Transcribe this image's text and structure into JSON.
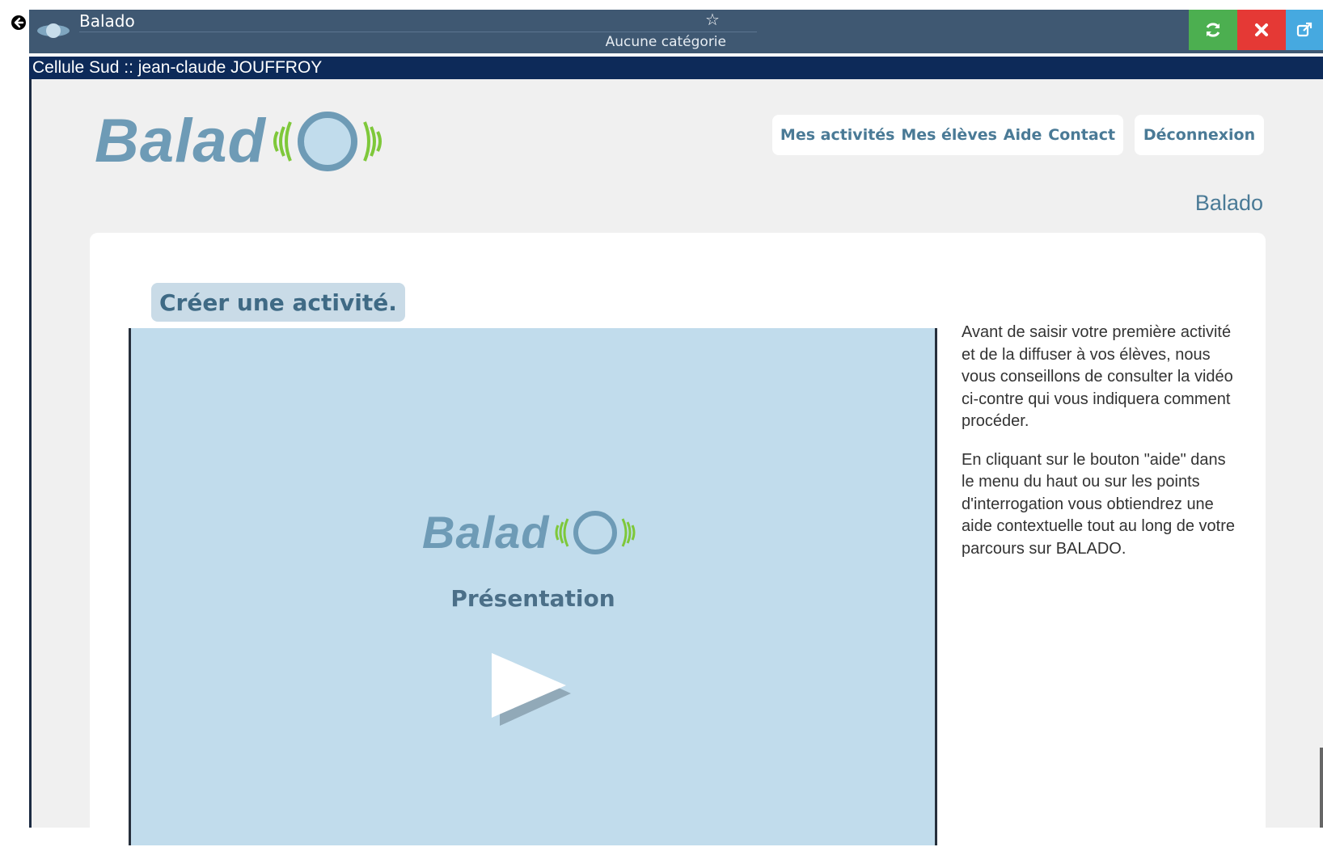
{
  "appbar": {
    "title": "Balado",
    "category": "Aucune catégorie"
  },
  "userbar": {
    "text": "Cellule Sud :: jean-claude JOUFFROY"
  },
  "logo": {
    "text": "Balad"
  },
  "nav": {
    "items": [
      {
        "label": "Mes activités"
      },
      {
        "label": "Mes élèves"
      },
      {
        "label": "Aide"
      },
      {
        "label": "Contact"
      }
    ],
    "logout": "Déconnexion"
  },
  "page": {
    "heading": "Balado",
    "create_button": "Créer une activité.",
    "video": {
      "logo_text": "Balad",
      "caption": "Présentation"
    },
    "side_paragraphs": [
      "Avant de saisir votre première activité et de la diffuser à vos élèves, nous vous conseillons de consulter la vidéo ci-contre qui vous indiquera comment procéder.",
      "En cliquant sur le bouton \"aide\" dans le menu du haut ou sur les points d'interrogation vous obtiendrez une aide contextuelle tout au long de votre parcours sur BALADO."
    ]
  },
  "icons": {
    "back": "back-arrow-icon",
    "star": "star-icon",
    "refresh": "refresh-icon",
    "close": "close-icon",
    "external": "external-link-icon",
    "play": "play-icon"
  },
  "colors": {
    "appbar": "#3f5872",
    "userbar": "#0d2a59",
    "refresh": "#4caf50",
    "close": "#e53935",
    "external": "#46a9e0",
    "accent": "#4a7a96",
    "logo": "#6e9bb6",
    "logo_waves": "#7ec83a",
    "video_bg": "#c1dcec"
  }
}
